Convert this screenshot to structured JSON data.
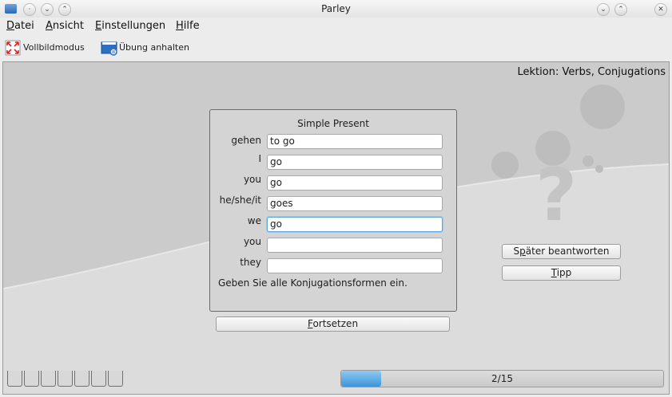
{
  "window": {
    "title": "Parley"
  },
  "menubar": {
    "items": [
      {
        "accel": "D",
        "rest": "atei"
      },
      {
        "accel": "A",
        "rest": "nsicht"
      },
      {
        "accel": "E",
        "rest": "instellungen"
      },
      {
        "accel": "H",
        "rest": "ilfe"
      }
    ]
  },
  "toolbar": {
    "fullscreen": "Vollbildmodus",
    "pause": "Übung anhalten"
  },
  "lesson": "Lektion: Verbs, Conjugations",
  "exercise": {
    "title": "Simple Present",
    "rows": [
      {
        "label": "gehen",
        "value": "to go"
      },
      {
        "label": "I",
        "value": "go"
      },
      {
        "label": "you",
        "value": "go"
      },
      {
        "label": "he/she/it",
        "value": "goes"
      },
      {
        "label": "we",
        "value": "go"
      },
      {
        "label": "you",
        "value": ""
      },
      {
        "label": "they",
        "value": ""
      }
    ],
    "focused_index": 4,
    "hint": "Geben Sie alle Konjugationsformen ein."
  },
  "buttons": {
    "continue": {
      "accel": "F",
      "rest": "ortsetzen"
    },
    "later": {
      "pre": "S",
      "accel": "p",
      "rest": "äter beantworten"
    },
    "tip": {
      "accel": "T",
      "rest": "ipp"
    }
  },
  "progress": {
    "text": "2/15",
    "fraction": 0.125
  },
  "colors": {
    "progress_fill": "#3d94d8",
    "focus_border": "#5fa6de"
  }
}
